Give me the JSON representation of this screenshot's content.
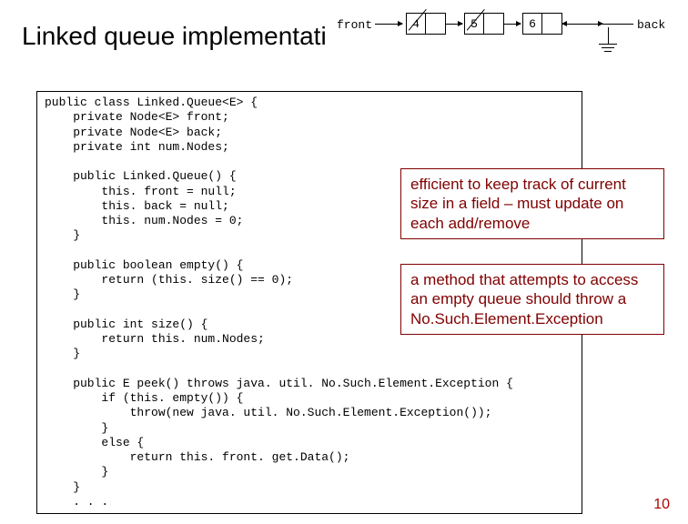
{
  "title": "Linked queue implementati",
  "diagram": {
    "front_label": "front",
    "back_label": "back",
    "nodes": [
      "4",
      "5",
      "6"
    ]
  },
  "code": "public class Linked.Queue<E> {\n    private Node<E> front;\n    private Node<E> back;\n    private int num.Nodes;\n\n    public Linked.Queue() {\n        this. front = null;\n        this. back = null;\n        this. num.Nodes = 0;\n    }\n\n    public boolean empty() {\n        return (this. size() == 0);\n    }\n\n    public int size() {\n        return this. num.Nodes;\n    }\n\n    public E peek() throws java. util. No.Such.Element.Exception {\n        if (this. empty()) {\n            throw(new java. util. No.Such.Element.Exception());\n        }\n        else {\n            return this. front. get.Data();\n        }\n    }\n    . . .",
  "callout1": "efficient to keep track of current size in a field – must update on each add/remove",
  "callout2": "a method that attempts to access an empty queue should throw a No.Such.Element.Exception",
  "page_number": "10"
}
